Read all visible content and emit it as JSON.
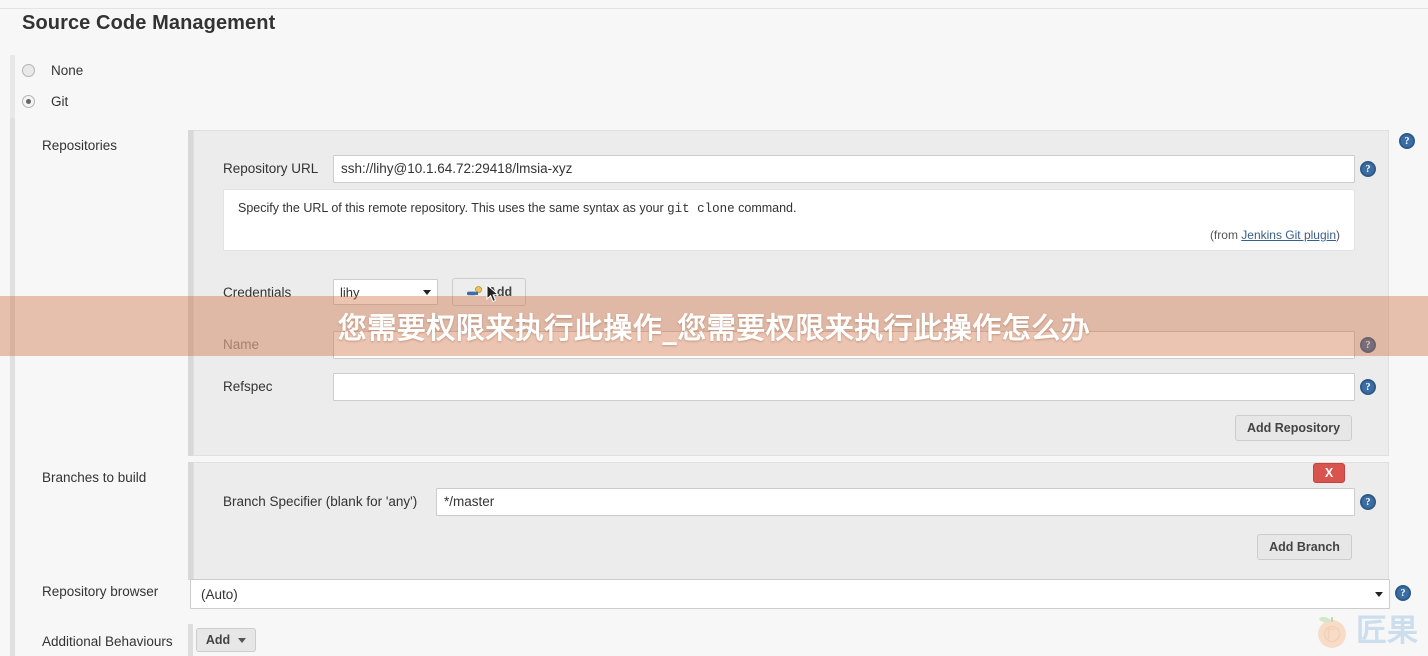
{
  "page": {
    "title": "Source Code Management"
  },
  "scm_options": [
    {
      "label": "None",
      "checked": false
    },
    {
      "label": "Git",
      "checked": true
    }
  ],
  "sections": {
    "repositories_label": "Repositories",
    "branches_label": "Branches to build",
    "repository_browser_label": "Repository browser",
    "additional_behaviours_label": "Additional Behaviours"
  },
  "repository": {
    "url_label": "Repository URL",
    "url_value": "ssh://lihy@10.1.64.72:29418/lmsia-xyz",
    "help_text_1": "Specify the URL of this remote repository. This uses the same syntax as your ",
    "help_text_code": "git clone",
    "help_text_2": " command.",
    "from_prefix": "(from ",
    "from_link": "Jenkins Git plugin",
    "from_suffix": ")",
    "credentials_label": "Credentials",
    "credentials_value": "lihy",
    "add_credentials_label": "Add",
    "name_label": "Name",
    "name_value": "",
    "refspec_label": "Refspec",
    "refspec_value": "",
    "add_repository_label": "Add Repository"
  },
  "branches": {
    "specifier_label": "Branch Specifier (blank for 'any')",
    "specifier_value": "*/master",
    "delete_label": "X",
    "add_branch_label": "Add Branch"
  },
  "repository_browser": {
    "value": "(Auto)"
  },
  "additional_behaviours": {
    "add_label": "Add"
  },
  "help_icon_glyph": "?",
  "overlay": {
    "text": "您需要权限来执行此操作_您需要权限来执行此操作怎么办",
    "color": "#d06e3e"
  },
  "watermark": {
    "text": "匠果"
  },
  "colors": {
    "page_bg": "#f7f7f7",
    "panel_bg": "#ececec",
    "help_icon": "#3b6ea5",
    "delete_button": "#d9534f",
    "link": "#3a5f8a"
  }
}
